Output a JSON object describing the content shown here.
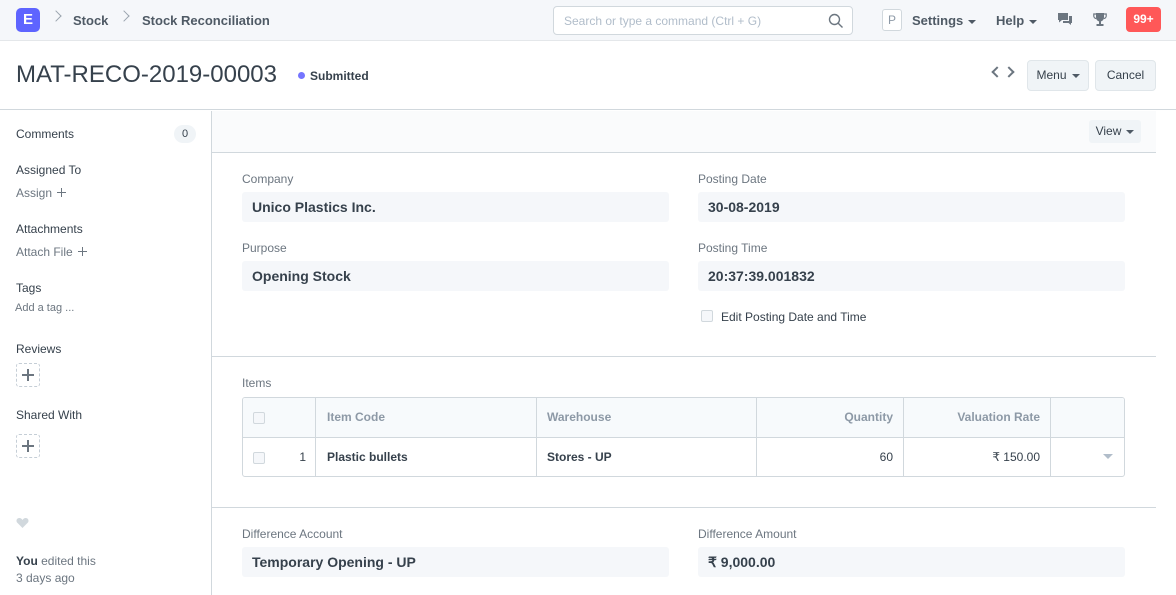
{
  "navbar": {
    "logo_letter": "E",
    "breadcrumbs": [
      "Stock",
      "Stock Reconciliation"
    ],
    "search_placeholder": "Search or type a command (Ctrl + G)",
    "avatar_letter": "P",
    "settings_label": "Settings",
    "help_label": "Help",
    "notifications_count": "99+"
  },
  "page": {
    "title": "MAT-RECO-2019-00003",
    "status": "Submitted",
    "menu_label": "Menu",
    "cancel_label": "Cancel"
  },
  "sidebar": {
    "comments_label": "Comments",
    "comments_count": "0",
    "assigned_to_label": "Assigned To",
    "assign_link": "Assign",
    "attachments_label": "Attachments",
    "attach_file_link": "Attach File",
    "tags_label": "Tags",
    "add_tag_link": "Add a tag ...",
    "reviews_label": "Reviews",
    "shared_with_label": "Shared With",
    "activity_user": "You",
    "activity_text": " edited this",
    "activity_time": "3 days ago"
  },
  "form": {
    "view_label": "View",
    "company_label": "Company",
    "company_value": "Unico Plastics Inc.",
    "posting_date_label": "Posting Date",
    "posting_date_value": "30-08-2019",
    "purpose_label": "Purpose",
    "purpose_value": "Opening Stock",
    "posting_time_label": "Posting Time",
    "posting_time_value": "20:37:39.001832",
    "edit_posting_label": "Edit Posting Date and Time",
    "items_label": "Items",
    "difference_account_label": "Difference Account",
    "difference_account_value": "Temporary Opening - UP",
    "difference_amount_label": "Difference Amount",
    "difference_amount_value": "₹ 9,000.00"
  },
  "items_table": {
    "columns": [
      "Item Code",
      "Warehouse",
      "Quantity",
      "Valuation Rate"
    ],
    "rows": [
      {
        "idx": "1",
        "item_code": "Plastic bullets",
        "warehouse": "Stores - UP",
        "quantity": "60",
        "valuation_rate": "₹ 150.00"
      }
    ]
  },
  "icons": {
    "search": "search-icon",
    "chat": "chat-icon",
    "trophy": "trophy-icon",
    "heart": "heart-icon"
  },
  "colors": {
    "brand": "#5e64ff",
    "status_dot": "#7575ff",
    "notification": "#ff5858"
  }
}
